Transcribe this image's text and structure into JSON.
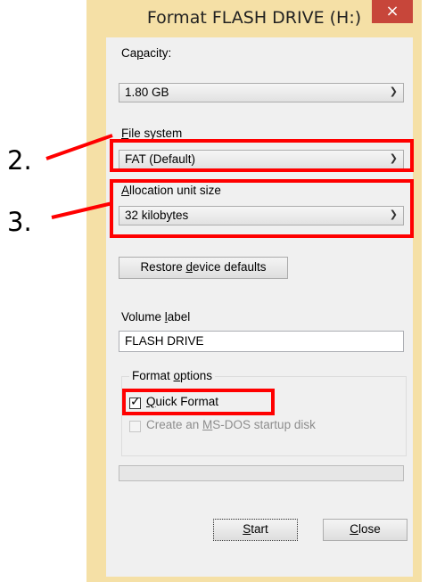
{
  "window": {
    "title": "Format FLASH DRIVE (H:)",
    "close_glyph": "×"
  },
  "capacity": {
    "label": "Capacity:",
    "value": "1.80 GB"
  },
  "file_system": {
    "label": "File system",
    "value": "FAT (Default)"
  },
  "allocation": {
    "label": "Allocation unit size",
    "value": "32 kilobytes"
  },
  "restore_button": {
    "label": "Restore device defaults"
  },
  "volume": {
    "label": "Volume label",
    "value": "FLASH DRIVE"
  },
  "format_options": {
    "title": "Format options",
    "quick_format": {
      "label": "Quick Format",
      "checked": true
    },
    "msdos": {
      "label": "Create an MS-DOS startup disk",
      "checked": false,
      "enabled": false
    }
  },
  "progress": {
    "value": 0
  },
  "buttons": {
    "start": "Start",
    "close": "Close"
  },
  "annotations": {
    "step2": "2.",
    "step3": "3.",
    "color": "#ff0000"
  },
  "icons": {
    "combo_arrow": "chevron-down-icon",
    "checkbox_mark": "check-icon"
  },
  "colors": {
    "frame": "#f5e0a6",
    "close_button": "#c7463a",
    "client": "#f0f0f0"
  }
}
